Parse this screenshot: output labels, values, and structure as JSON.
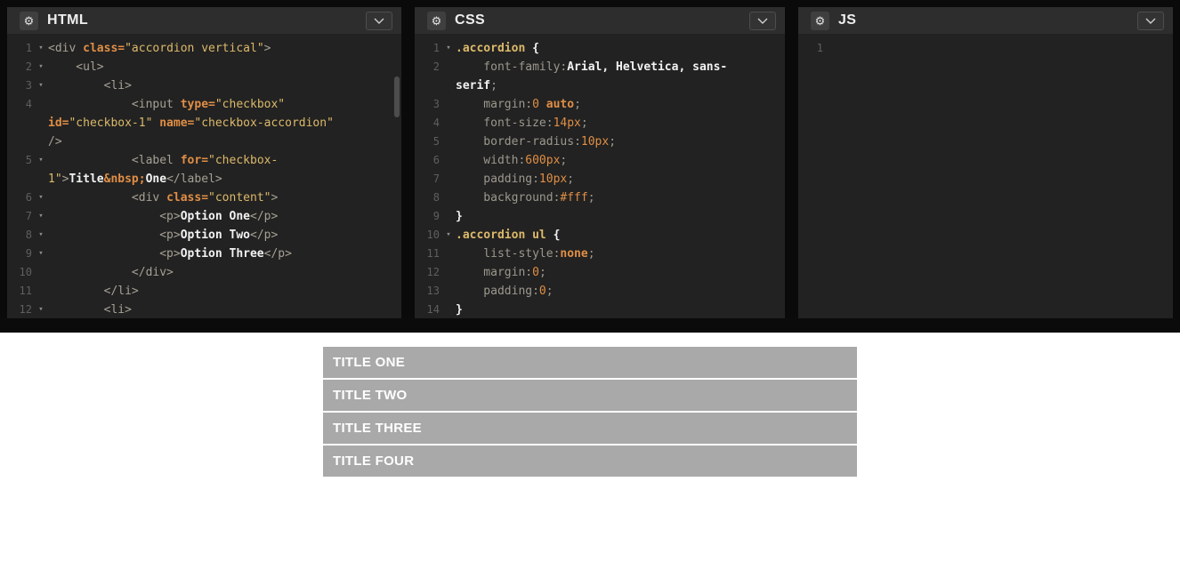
{
  "theme": {
    "frame_bg": "#0a0a0a",
    "header_bg": "#2d2d2d",
    "editor_bg": "#222222",
    "tag": "#a6a094",
    "attr": "#e08e45",
    "string": "#dcb96a",
    "text_bold": "#f2f2f2",
    "property": "#9c988e",
    "line_number": "#5f5f5f",
    "accordion_bar": "#a9a9a9",
    "accordion_text": "#ffffff",
    "preview_bg": "#ffffff"
  },
  "icons": {
    "settings": "gear-icon",
    "menu": "chevron-down-icon",
    "fold": "fold-arrow-icon"
  },
  "panels": [
    {
      "title": "HTML",
      "lines": [
        {
          "n": "1",
          "fold": true,
          "t": [
            [
              "tag",
              "<div "
            ],
            [
              "attr",
              "class="
            ],
            [
              "str",
              "\"accordion vertical\""
            ],
            [
              "tag",
              ">"
            ]
          ]
        },
        {
          "n": "2",
          "fold": true,
          "t": [
            [
              "tag",
              "    <ul>"
            ]
          ]
        },
        {
          "n": "3",
          "fold": true,
          "t": [
            [
              "tag",
              "        <li>"
            ]
          ]
        },
        {
          "n": "4",
          "t": [
            [
              "tag",
              "            <input "
            ],
            [
              "attr",
              "type="
            ],
            [
              "str",
              "\"checkbox\""
            ]
          ]
        },
        {
          "t": [
            [
              "attr",
              "id="
            ],
            [
              "str",
              "\"checkbox-1\""
            ],
            [
              "plain",
              " "
            ],
            [
              "attr",
              "name="
            ],
            [
              "str",
              "\"checkbox-accordion\""
            ]
          ]
        },
        {
          "t": [
            [
              "tag",
              "/>"
            ]
          ]
        },
        {
          "n": "5",
          "fold": true,
          "t": [
            [
              "tag",
              "            <label "
            ],
            [
              "attr",
              "for="
            ],
            [
              "str",
              "\"checkbox-"
            ]
          ]
        },
        {
          "t": [
            [
              "str",
              "1\""
            ],
            [
              "tag",
              ">"
            ],
            [
              "txt",
              "Title"
            ],
            [
              "ent",
              "&nbsp;"
            ],
            [
              "txt",
              "One"
            ],
            [
              "tag",
              "</label>"
            ]
          ]
        },
        {
          "n": "6",
          "fold": true,
          "t": [
            [
              "tag",
              "            <div "
            ],
            [
              "attr",
              "class="
            ],
            [
              "str",
              "\"content\""
            ],
            [
              "tag",
              ">"
            ]
          ]
        },
        {
          "n": "7",
          "fold": true,
          "t": [
            [
              "tag",
              "                <p>"
            ],
            [
              "txt",
              "Option One"
            ],
            [
              "tag",
              "</p>"
            ]
          ]
        },
        {
          "n": "8",
          "fold": true,
          "t": [
            [
              "tag",
              "                <p>"
            ],
            [
              "txt",
              "Option Two"
            ],
            [
              "tag",
              "</p>"
            ]
          ]
        },
        {
          "n": "9",
          "fold": true,
          "t": [
            [
              "tag",
              "                <p>"
            ],
            [
              "txt",
              "Option Three"
            ],
            [
              "tag",
              "</p>"
            ]
          ]
        },
        {
          "n": "10",
          "t": [
            [
              "tag",
              "            </div>"
            ]
          ]
        },
        {
          "n": "11",
          "t": [
            [
              "tag",
              "        </li>"
            ]
          ]
        },
        {
          "n": "12",
          "fold": true,
          "t": [
            [
              "tag",
              "        <li>"
            ]
          ]
        }
      ]
    },
    {
      "title": "CSS",
      "lines": [
        {
          "n": "1",
          "fold": true,
          "t": [
            [
              "sel",
              ".accordion "
            ],
            [
              "brace",
              "{"
            ]
          ]
        },
        {
          "n": "2",
          "t": [
            [
              "prop",
              "    font-family"
            ],
            [
              "pun",
              ":"
            ],
            [
              "kw",
              "Arial, Helvetica, sans-"
            ]
          ]
        },
        {
          "t": [
            [
              "kw",
              "serif"
            ],
            [
              "pun",
              ";"
            ]
          ]
        },
        {
          "n": "3",
          "t": [
            [
              "prop",
              "    margin"
            ],
            [
              "pun",
              ":"
            ],
            [
              "num",
              "0"
            ],
            [
              "plain",
              " "
            ],
            [
              "kwv",
              "auto"
            ],
            [
              "pun",
              ";"
            ]
          ]
        },
        {
          "n": "4",
          "t": [
            [
              "prop",
              "    font-size"
            ],
            [
              "pun",
              ":"
            ],
            [
              "num",
              "14px"
            ],
            [
              "pun",
              ";"
            ]
          ]
        },
        {
          "n": "5",
          "t": [
            [
              "prop",
              "    border-radius"
            ],
            [
              "pun",
              ":"
            ],
            [
              "num",
              "10px"
            ],
            [
              "pun",
              ";"
            ]
          ]
        },
        {
          "n": "6",
          "t": [
            [
              "prop",
              "    width"
            ],
            [
              "pun",
              ":"
            ],
            [
              "num",
              "600px"
            ],
            [
              "pun",
              ";"
            ]
          ]
        },
        {
          "n": "7",
          "t": [
            [
              "prop",
              "    padding"
            ],
            [
              "pun",
              ":"
            ],
            [
              "num",
              "10px"
            ],
            [
              "pun",
              ";"
            ]
          ]
        },
        {
          "n": "8",
          "t": [
            [
              "prop",
              "    background"
            ],
            [
              "pun",
              ":"
            ],
            [
              "num",
              "#fff"
            ],
            [
              "pun",
              ";"
            ]
          ]
        },
        {
          "n": "9",
          "t": [
            [
              "brace",
              "}"
            ]
          ]
        },
        {
          "n": "10",
          "fold": true,
          "t": [
            [
              "sel",
              ".accordion ul "
            ],
            [
              "brace",
              "{"
            ]
          ]
        },
        {
          "n": "11",
          "t": [
            [
              "prop",
              "    list-style"
            ],
            [
              "pun",
              ":"
            ],
            [
              "kwv",
              "none"
            ],
            [
              "pun",
              ";"
            ]
          ]
        },
        {
          "n": "12",
          "t": [
            [
              "prop",
              "    margin"
            ],
            [
              "pun",
              ":"
            ],
            [
              "num",
              "0"
            ],
            [
              "pun",
              ";"
            ]
          ]
        },
        {
          "n": "13",
          "t": [
            [
              "prop",
              "    padding"
            ],
            [
              "pun",
              ":"
            ],
            [
              "num",
              "0"
            ],
            [
              "pun",
              ";"
            ]
          ]
        },
        {
          "n": "14",
          "t": [
            [
              "brace",
              "}"
            ]
          ]
        }
      ]
    },
    {
      "title": "JS",
      "lines": [
        {
          "n": "1",
          "t": []
        }
      ]
    }
  ],
  "preview": {
    "accordion": {
      "titles": [
        "TITLE ONE",
        "TITLE TWO",
        "TITLE THREE",
        "TITLE FOUR"
      ]
    }
  }
}
